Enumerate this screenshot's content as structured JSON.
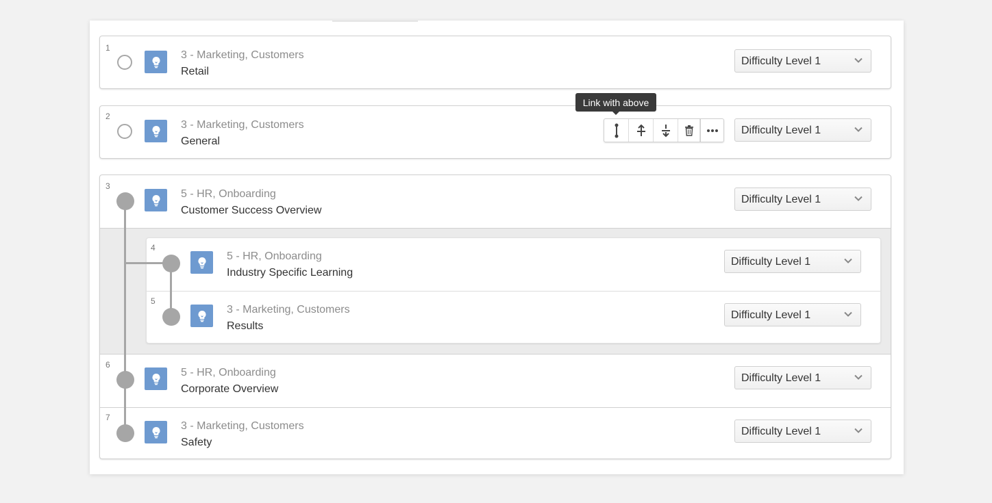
{
  "tooltip": "Link with above",
  "toolbar": {
    "link_icon": "link-vertical-icon",
    "move_up_icon": "move-up-icon",
    "move_down_icon": "move-down-icon",
    "delete_icon": "trash-icon",
    "more_icon": "more-icon"
  },
  "items": [
    {
      "number": "1",
      "subtitle": "3 - Marketing, Customers",
      "title": "Retail",
      "difficulty": "Difficulty Level 1"
    },
    {
      "number": "2",
      "subtitle": "3 - Marketing, Customers",
      "title": "General",
      "difficulty": "Difficulty Level 1"
    },
    {
      "number": "3",
      "subtitle": "5 - HR, Onboarding",
      "title": "Customer Success Overview",
      "difficulty": "Difficulty Level 1"
    },
    {
      "number": "4",
      "subtitle": "5 - HR, Onboarding",
      "title": "Industry Specific Learning",
      "difficulty": "Difficulty Level 1"
    },
    {
      "number": "5",
      "subtitle": "3 - Marketing, Customers",
      "title": "Results",
      "difficulty": "Difficulty Level 1"
    },
    {
      "number": "6",
      "subtitle": "5 - HR, Onboarding",
      "title": "Corporate Overview",
      "difficulty": "Difficulty Level 1"
    },
    {
      "number": "7",
      "subtitle": "3 - Marketing, Customers",
      "title": "Safety",
      "difficulty": "Difficulty Level 1"
    }
  ],
  "colors": {
    "accent": "#6e9ad0",
    "connector": "#a6a6a6"
  }
}
